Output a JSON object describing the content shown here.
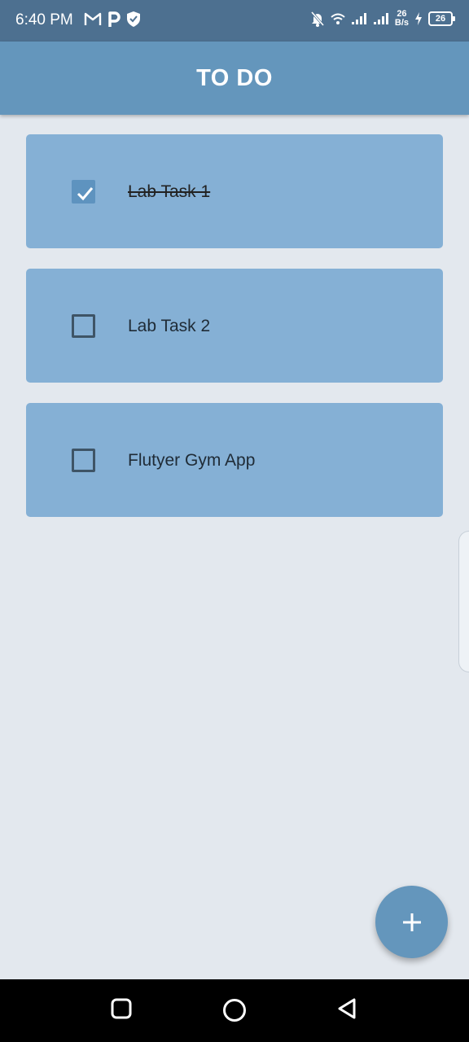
{
  "status_bar": {
    "time": "6:40 PM",
    "left_icons": [
      "gmail-icon",
      "p-icon",
      "shield-icon"
    ],
    "network_speed_value": "26",
    "network_speed_unit": "B/s",
    "battery": "26",
    "right_icons": [
      "bell-off-icon",
      "wifi-icon",
      "signal-icon",
      "signal-icon",
      "charging-icon",
      "battery-icon"
    ]
  },
  "app_bar": {
    "title": "TO DO"
  },
  "todos": [
    {
      "text": "Lab Task 1",
      "checked": true
    },
    {
      "text": "Lab Task 2",
      "checked": false
    },
    {
      "text": "Flutyer Gym App",
      "checked": false
    }
  ],
  "fab": {
    "icon": "plus-icon"
  },
  "nav_bar": {
    "buttons": [
      "recents-button",
      "home-button",
      "back-button"
    ]
  },
  "colors": {
    "status_bar": "#4d7090",
    "app_bar": "#6496bc",
    "card": "#85b0d5",
    "background": "#e3e8ee",
    "checkbox_checked": "#5e93bf"
  }
}
